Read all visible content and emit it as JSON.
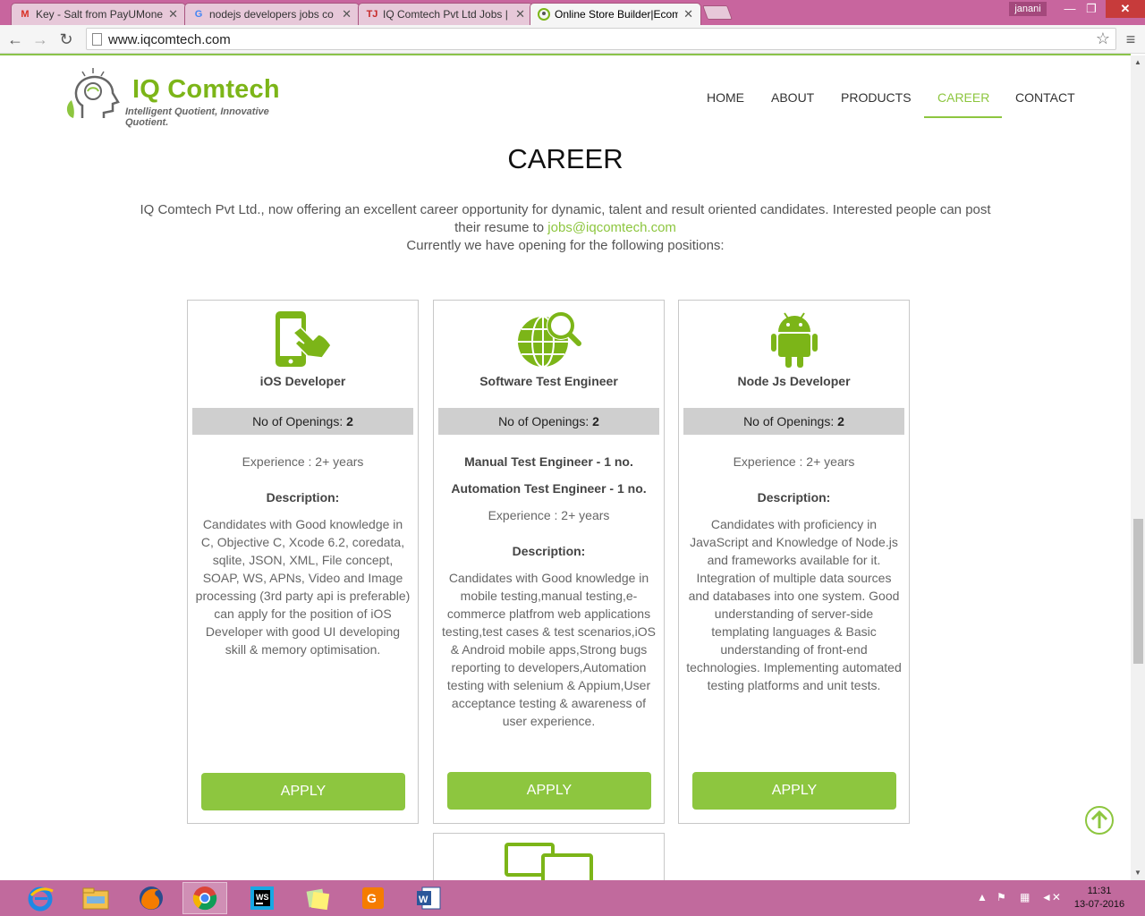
{
  "browser": {
    "tabs": [
      {
        "label": "Key - Salt from PayUMone",
        "favicon": "gmail-icon",
        "active": false
      },
      {
        "label": "nodejs developers jobs co",
        "favicon": "google-icon",
        "active": false
      },
      {
        "label": "IQ Comtech Pvt Ltd Jobs |",
        "favicon": "timesjobs-icon",
        "active": false
      },
      {
        "label": "Online Store Builder|Ecom",
        "favicon": "iq-comtech-icon",
        "active": true
      }
    ],
    "user": "janani",
    "url": "www.iqcomtech.com"
  },
  "site": {
    "brand": "IQ Comtech",
    "tagline": "Intelligent Quotient, Innovative Quotient.",
    "nav": [
      "HOME",
      "ABOUT",
      "PRODUCTS",
      "CAREER",
      "CONTACT"
    ],
    "active_nav": "CAREER",
    "accent_color": "#8dc63f"
  },
  "page": {
    "title": "CAREER",
    "intro_1": "IQ Comtech Pvt Ltd., now offering an excellent career opportunity for dynamic, talent and result oriented candidates. Interested people can post their resume to",
    "email": "jobs@iqcomtech.com",
    "intro_2": "Currently we have opening for the following positions:"
  },
  "jobs": [
    {
      "icon": "mobile-touch-icon",
      "title": "iOS Developer",
      "openings_label": "No of Openings:",
      "openings": "2",
      "experience": "Experience : 2+ years",
      "description_label": "Description:",
      "description": "Candidates with Good knowledge in C, Objective C, Xcode 6.2, coredata, sqlite, JSON, XML, File concept, SOAP, WS, APNs, Video and Image processing (3rd party api is preferable) can apply for the position of iOS Developer with good UI developing skill & memory optimisation.",
      "apply": "APPLY"
    },
    {
      "icon": "globe-search-icon",
      "title": "Software Test Engineer",
      "openings_label": "No of Openings:",
      "openings": "2",
      "role_1": "Manual Test Engineer - 1 no.",
      "role_2": "Automation Test Engineer - 1 no.",
      "experience": "Experience : 2+ years",
      "description_label": "Description:",
      "description": "Candidates with Good knowledge in mobile testing,manual testing,e-commerce platfrom web applications testing,test cases & test scenarios,iOS & Android mobile apps,Strong bugs reporting to developers,Automation testing with selenium & Appium,User acceptance testing & awareness of user experience.",
      "apply": "APPLY"
    },
    {
      "icon": "android-icon",
      "title": "Node Js Developer",
      "openings_label": "No of Openings:",
      "openings": "2",
      "experience": "Experience : 2+ years",
      "description_label": "Description:",
      "description": "Candidates with proficiency in JavaScript and Knowledge of Node.js and frameworks available for it. Integration of multiple data sources and databases into one system. Good understanding of server-side templating languages & Basic understanding of front-end technologies. Implementing automated testing platforms and unit tests.",
      "apply": "APPLY"
    }
  ],
  "taskbar": {
    "apps": [
      "internet-explorer-icon",
      "file-explorer-icon",
      "firefox-icon",
      "chrome-icon",
      "webstorm-icon",
      "sticky-notes-icon",
      "foxit-pdf-icon",
      "word-icon"
    ],
    "time": "11:31",
    "date": "13-07-2016"
  }
}
